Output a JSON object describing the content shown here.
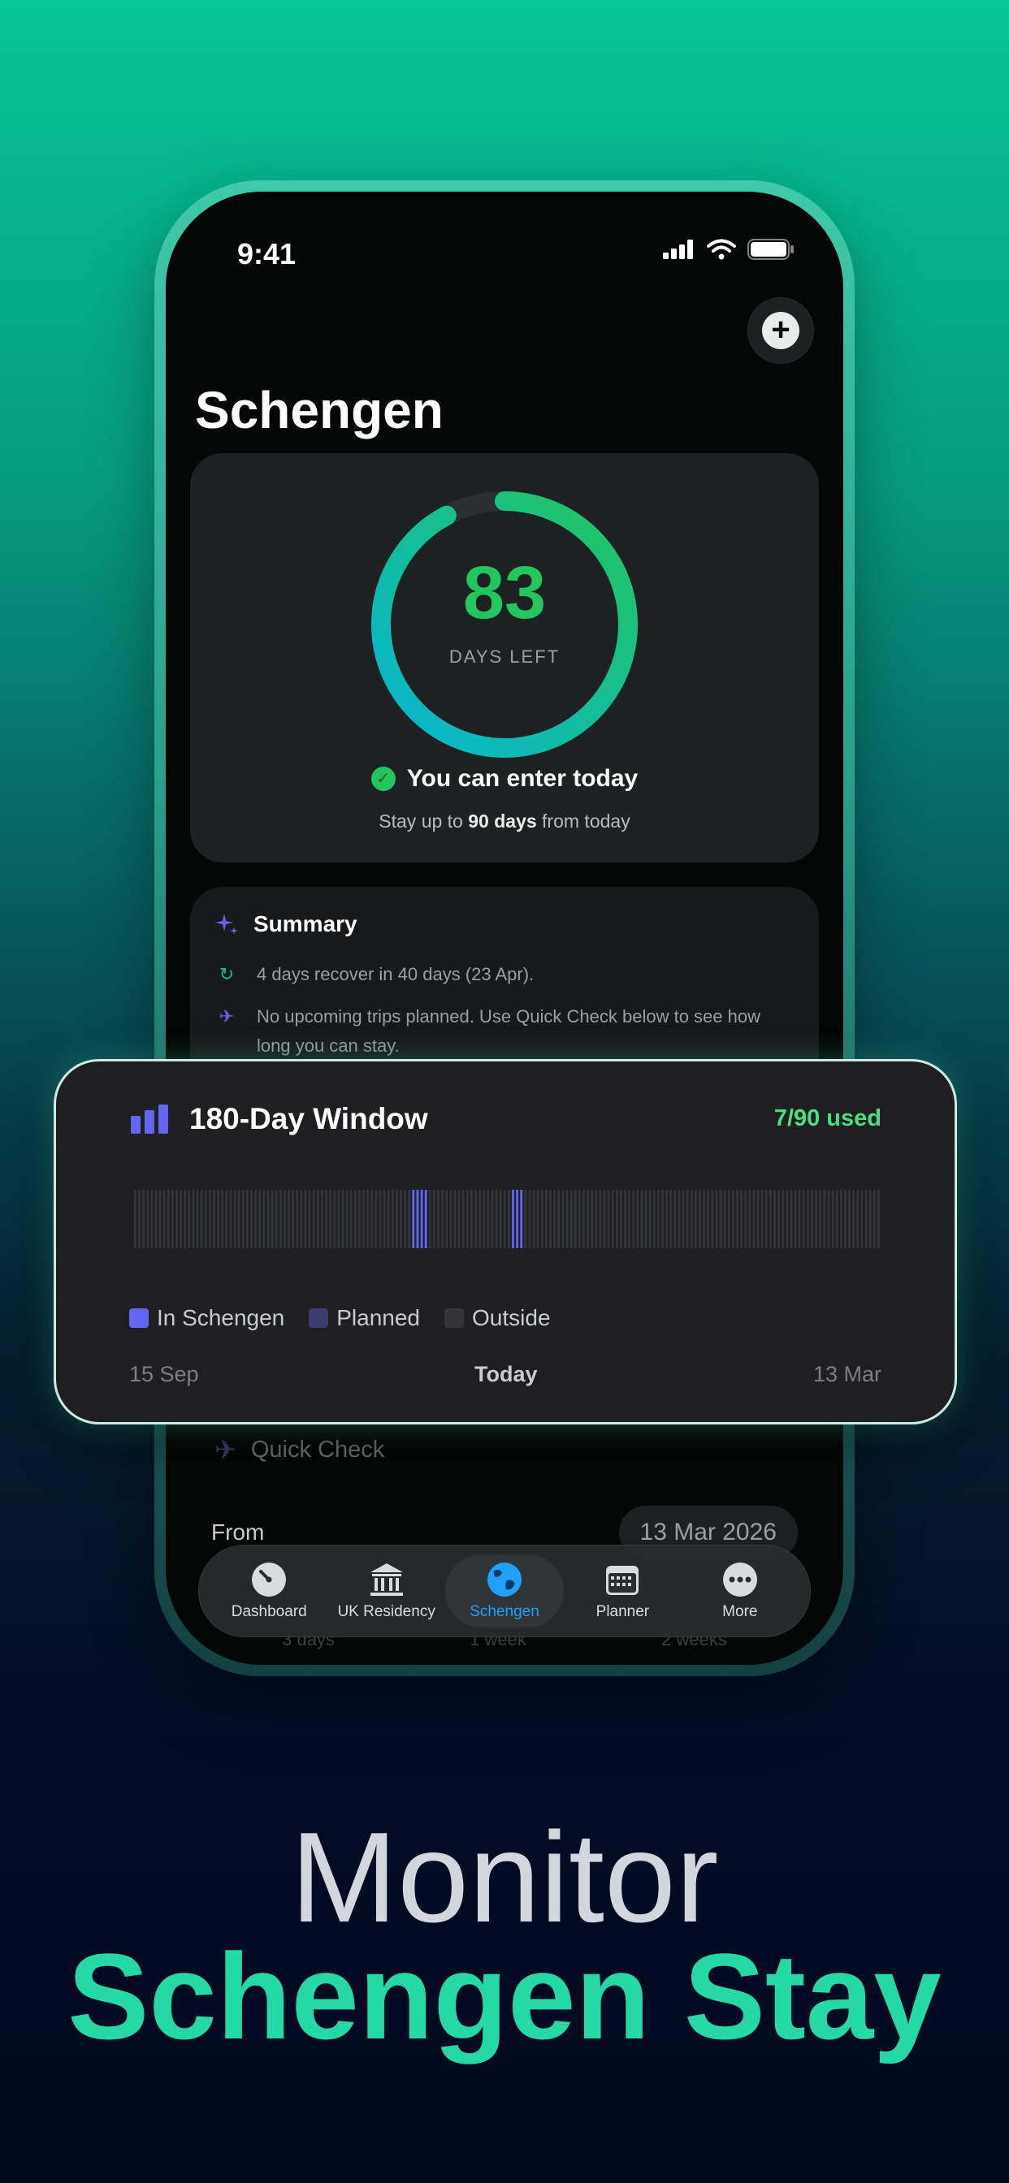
{
  "status_bar": {
    "time": "9:41"
  },
  "screen": {
    "title": "Schengen",
    "gauge": {
      "days_left": "83",
      "caption": "DAYS LEFT",
      "fraction_remaining": 0.922,
      "colors": {
        "start": "#06b6d4",
        "end": "#22c55e",
        "track": "#2b2f30"
      }
    },
    "enter_status": "You can enter today",
    "stay_prefix": "Stay up to ",
    "stay_bold": "90 days",
    "stay_suffix": " from today",
    "summary": {
      "title": "Summary",
      "line1": "4 days recover in 40 days (23 Apr).",
      "line2": "No upcoming trips planned. Use Quick Check below to see how long you can stay."
    },
    "quick_check": {
      "title": "Quick Check",
      "from_label": "From",
      "from_value": "13 Mar 2026",
      "ghost_options": [
        "3 days",
        "1 week",
        "2 weeks"
      ]
    }
  },
  "tabbar": {
    "items": [
      {
        "label": "Dashboard",
        "icon": "gauge-icon"
      },
      {
        "label": "UK Residency",
        "icon": "bank-icon"
      },
      {
        "label": "Schengen",
        "icon": "globe-icon",
        "active": true
      },
      {
        "label": "Planner",
        "icon": "calendar-icon"
      },
      {
        "label": "More",
        "icon": "ellipsis-icon"
      }
    ],
    "active_color": "#1ea1ff"
  },
  "window_card": {
    "title": "180-Day Window",
    "used": "7/90 used",
    "legend": [
      {
        "label": "In Schengen",
        "color": "#6366f1"
      },
      {
        "label": "Planned",
        "color": "#3b3d6e"
      },
      {
        "label": "Outside",
        "color": "#333538"
      }
    ],
    "axis": {
      "start": "15 Sep",
      "middle": "Today",
      "end": "13 Mar"
    },
    "days_total": 180,
    "schengen_day_indices": [
      67,
      68,
      69,
      70,
      91,
      92,
      93
    ]
  },
  "promo": {
    "line1": "Monitor",
    "line2": "Schengen Stay"
  }
}
